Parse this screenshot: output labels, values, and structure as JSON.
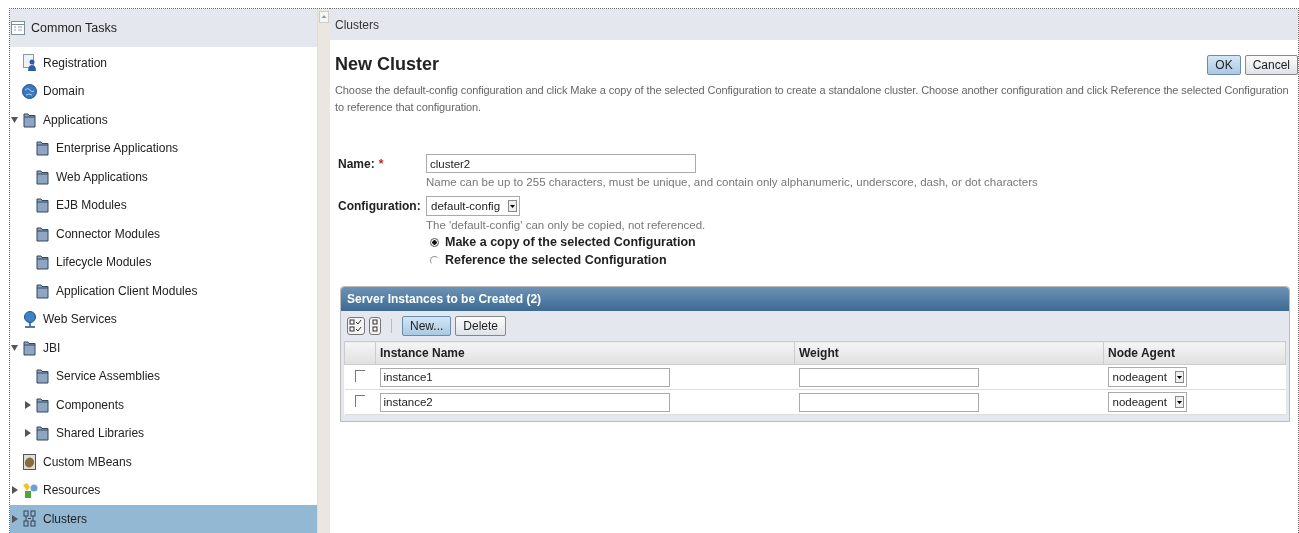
{
  "sidebar": {
    "header": "Common Tasks",
    "items": [
      {
        "label": "Registration",
        "kind": "registration",
        "selected": false
      },
      {
        "label": "Domain",
        "kind": "globe",
        "selected": false
      },
      {
        "label": "Applications",
        "kind": "folder",
        "selected": false,
        "expanded": true,
        "children": [
          {
            "label": "Enterprise Applications",
            "kind": "folder",
            "selected": false
          },
          {
            "label": "Web Applications",
            "kind": "folder",
            "selected": false
          },
          {
            "label": "EJB Modules",
            "kind": "folder",
            "selected": false
          },
          {
            "label": "Connector Modules",
            "kind": "folder",
            "selected": false
          },
          {
            "label": "Lifecycle Modules",
            "kind": "folder",
            "selected": false
          },
          {
            "label": "Application Client Modules",
            "kind": "folder",
            "selected": false
          }
        ]
      },
      {
        "label": "Web Services",
        "kind": "webservice",
        "selected": false
      },
      {
        "label": "JBI",
        "kind": "folder",
        "selected": false,
        "expanded": true,
        "children": [
          {
            "label": "Service Assemblies",
            "kind": "folder",
            "selected": false
          },
          {
            "label": "Components",
            "kind": "folder",
            "selected": false,
            "expanded": false
          },
          {
            "label": "Shared Libraries",
            "kind": "folder",
            "selected": false,
            "expanded": false
          }
        ]
      },
      {
        "label": "Custom MBeans",
        "kind": "mbean",
        "selected": false
      },
      {
        "label": "Resources",
        "kind": "resources",
        "selected": false,
        "expanded": false
      },
      {
        "label": "Clusters",
        "kind": "clusters",
        "selected": true,
        "expanded": false
      }
    ]
  },
  "breadcrumb": "Clusters",
  "page": {
    "title": "New Cluster",
    "description": "Choose the default-config configuration and click Make a copy of the selected Configuration to create a standalone cluster. Choose another configuration and click Reference the selected Configuration to reference that configuration.",
    "buttons": [
      {
        "label": "OK",
        "primary": true
      },
      {
        "label": "Cancel",
        "primary": false
      }
    ]
  },
  "form": {
    "name": {
      "label": "Name:",
      "required_mark": "*",
      "value": "cluster2",
      "help": "Name can be up to 255 characters, must be unique, and contain only alphanumeric, underscore, dash, or dot characters"
    },
    "configuration": {
      "label": "Configuration:",
      "value": "default-config",
      "help": "The 'default-config' can only be copied, not referenced."
    },
    "options": [
      {
        "label": "Make a copy of the selected Configuration",
        "selected": true
      },
      {
        "label": "Reference the selected Configuration",
        "selected": false
      }
    ]
  },
  "table": {
    "title": "Server Instances to be Created (2)",
    "buttons": [
      {
        "label": "New...",
        "primary": true
      },
      {
        "label": "Delete",
        "primary": false
      }
    ],
    "columns": [
      "Instance Name",
      "Weight",
      "Node Agent"
    ],
    "rows": [
      {
        "checked": false,
        "instance_name": "instance1",
        "node_agent": "nodeagent"
      },
      {
        "checked": false,
        "instance_name": "instance2",
        "node_agent": "nodeagent"
      }
    ]
  }
}
